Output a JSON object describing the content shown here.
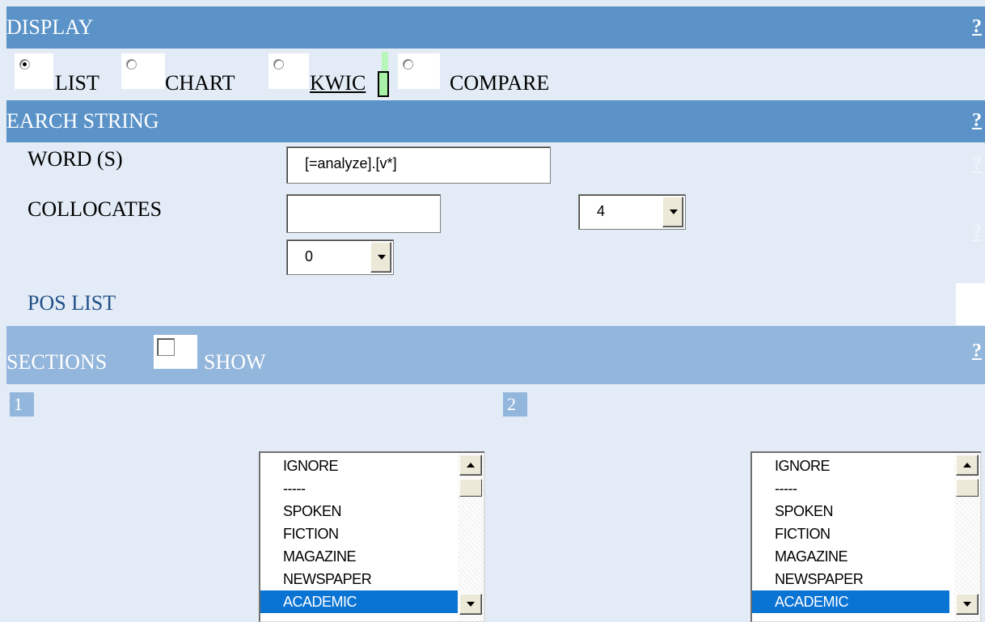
{
  "display": {
    "header": "DISPLAY",
    "help": "?",
    "options": [
      {
        "label": "LIST",
        "checked": true
      },
      {
        "label": "CHART",
        "checked": false
      },
      {
        "label": "KWIC",
        "checked": false
      },
      {
        "label": "COMPARE",
        "checked": false
      }
    ]
  },
  "search": {
    "header": "EARCH STRING",
    "help": "?",
    "words_label": "WORD (S)",
    "words_value": "[=analyze].[v*]",
    "words_help": "?",
    "collocates_label": "COLLOCATES",
    "collocates_value": "",
    "collocates_right_span": "4",
    "collocates_left_span": "0",
    "collocates_help": "?",
    "pos_list_label": "POS LIST"
  },
  "sections": {
    "header": "SECTIONS",
    "show_label": "SHOW",
    "help": "?",
    "show_checked": false,
    "panels": [
      {
        "number": "1",
        "items": [
          "IGNORE",
          "-----",
          "SPOKEN",
          "FICTION",
          "MAGAZINE",
          "NEWSPAPER",
          "ACADEMIC"
        ],
        "selected": "ACADEMIC"
      },
      {
        "number": "2",
        "items": [
          "IGNORE",
          "-----",
          "SPOKEN",
          "FICTION",
          "MAGAZINE",
          "NEWSPAPER",
          "ACADEMIC"
        ],
        "selected": "ACADEMIC"
      }
    ]
  },
  "colors": {
    "header_dark": "#5b93c8",
    "header_light": "#93b6dc",
    "background": "#e3ecf6",
    "selection": "#0a74d5"
  }
}
